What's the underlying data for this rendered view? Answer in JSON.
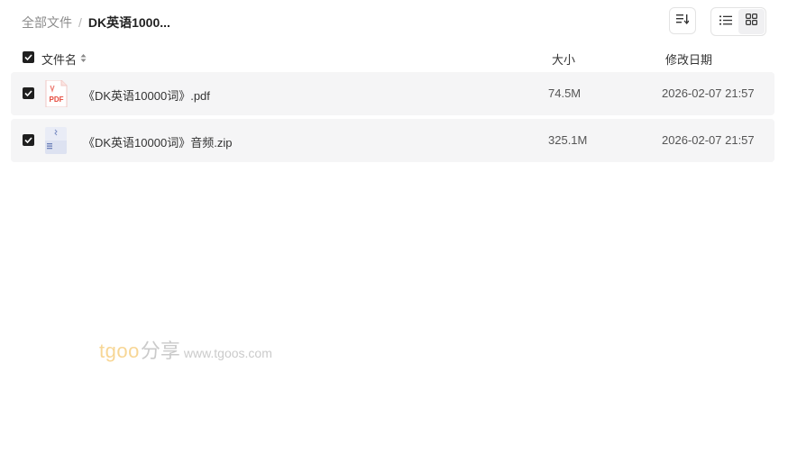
{
  "breadcrumb": {
    "root": "全部文件",
    "separator": "/",
    "current": "DK英语1000..."
  },
  "toolbar": {
    "sort_icon": "sort-icon",
    "list_view_icon": "list-view-icon",
    "grid_view_icon": "grid-view-icon",
    "active_view": "grid"
  },
  "table": {
    "columns": {
      "name": "文件名",
      "size": "大小",
      "modified": "修改日期"
    },
    "rows": [
      {
        "name": "《DK英语10000词》.pdf",
        "size": "74.5M",
        "modified": "2026-02-07 21:57",
        "icon": "pdf-file-icon",
        "icon_label": "PDF",
        "checked": true
      },
      {
        "name": "《DK英语10000词》音频.zip",
        "size": "325.1M",
        "modified": "2026-02-07 21:57",
        "icon": "zip-file-icon",
        "checked": true
      }
    ]
  },
  "watermark": {
    "brand": "tgoo",
    "chinese": "分享",
    "url": "www.tgoos.com"
  },
  "colors": {
    "row_background": "#f5f5f6",
    "checkbox": "#1f1f1f",
    "pdf_red": "#e5473a",
    "zip_blue": "#6b7fb8"
  }
}
